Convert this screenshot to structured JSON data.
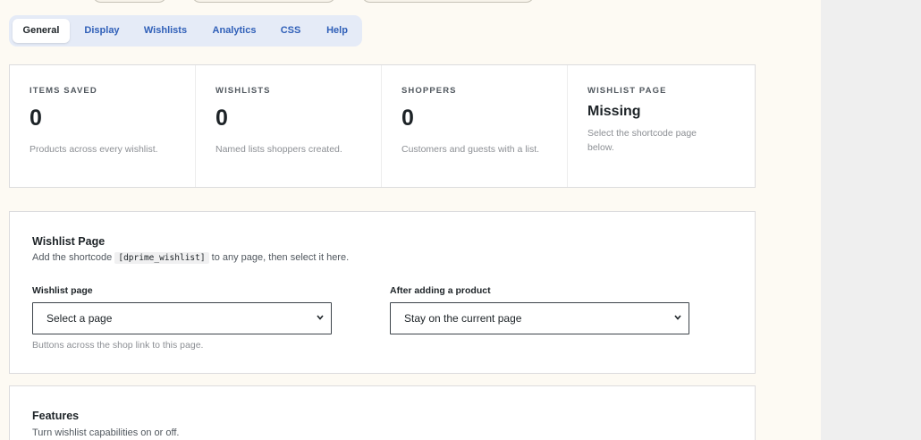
{
  "tabs": [
    {
      "label": "General",
      "active": true
    },
    {
      "label": "Display",
      "active": false
    },
    {
      "label": "Wishlists",
      "active": false
    },
    {
      "label": "Analytics",
      "active": false
    },
    {
      "label": "CSS",
      "active": false
    },
    {
      "label": "Help",
      "active": false
    }
  ],
  "stats": [
    {
      "label": "ITEMS SAVED",
      "value": "0",
      "description": "Products across every wishlist."
    },
    {
      "label": "WISHLISTS",
      "value": "0",
      "description": "Named lists shoppers created."
    },
    {
      "label": "SHOPPERS",
      "value": "0",
      "description": "Customers and guests with a list."
    },
    {
      "label": "WISHLIST PAGE",
      "value": "Missing",
      "description": "Select the shortcode page below."
    }
  ],
  "wishlist_page_card": {
    "title": "Wishlist Page",
    "subtitle_before": "Add the shortcode",
    "shortcode": "[dprime_wishlist]",
    "subtitle_after": "to any page, then select it here.",
    "page_field": {
      "label": "Wishlist page",
      "value": "Select a page"
    },
    "after_add_field": {
      "label": "After adding a product",
      "value": "Stay on the current page"
    },
    "hint": "Buttons across the shop link to this page."
  },
  "features_card": {
    "title": "Features",
    "subtitle": "Turn wishlist capabilities on or off."
  },
  "colors": {
    "accent": "#2f5fb8",
    "page_background": "#fdfaf3",
    "tab_bar": "#e5ebf7"
  }
}
